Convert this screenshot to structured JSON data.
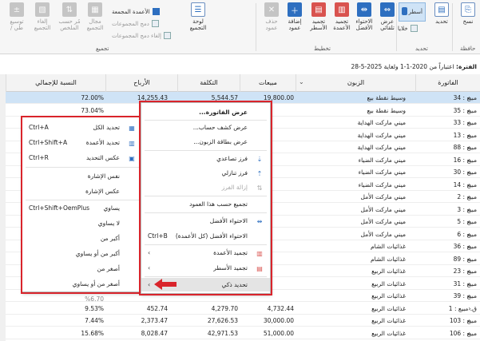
{
  "ribbon": {
    "nav_label": "حافظة",
    "nav_copy": "نسخ",
    "select_label": "تحديد",
    "active_button": "أسطر",
    "panels_label": "خلايا",
    "fit_best": "الاحتواء\nالأفضل",
    "fit_auto": "عرض\nتلقائي",
    "fit_all_cols": "تجميد\nالأعمدة",
    "freeze_rows": "تجميد\nالأسطر",
    "add_col": "إضافة\nعمود",
    "delete_col": "حذف\nعمود",
    "layout_group": "تخطيط",
    "group_panel": "لوحة\nالتجميع",
    "merge_cols": "الأعمدة المجمعة",
    "merge_groups": "دمج المجموعات",
    "cancel_merge": "إلغاء دمج المجموعات",
    "grouping_group": "تجميع",
    "sum_group": "مجال\nالتجميع",
    "calc_by": "مُر حسب\nالملخص",
    "cancel_group": "إلغاء\nالتجميع",
    "expand": "توسيع\n/ طي"
  },
  "filter": {
    "label": "الفترة:",
    "text": " اعتباراً من 2020-1-1 ولغاية 2025-5-28"
  },
  "grid": {
    "headers": {
      "invoice": "الفاتورة",
      "customer": "الزبون",
      "sales": "مبيعات",
      "cost": "التكلفة",
      "profit": "الأرباح",
      "pct": "النسبة للإجمالي"
    },
    "rows": [
      {
        "inv": "مبيع : 34",
        "cust": "وسيط نقطة بيع",
        "sales": "19,800.00",
        "cost": "5,544.57",
        "profit": "14,255.43",
        "pct": "72.00%"
      },
      {
        "inv": "مبيع : 35",
        "cust": "وسيط نقطة بيع",
        "sales": "",
        "cost": "",
        "profit": "",
        "pct": "73.04%"
      },
      {
        "inv": "مبيع : 33",
        "cust": "ميني ماركت الهداية",
        "sales": "",
        "cost": "",
        "profit": "",
        "pct": ""
      },
      {
        "inv": "مبيع : 13",
        "cust": "ميني ماركت الهداية",
        "sales": "",
        "cost": "",
        "profit": "",
        "pct": ""
      },
      {
        "inv": "مبيع : 88",
        "cust": "ميني ماركت الهداية",
        "sales": "",
        "cost": "",
        "profit": "",
        "pct": ""
      },
      {
        "inv": "مبيع : 16",
        "cust": "ميني ماركت الضياء",
        "sales": "",
        "cost": "",
        "profit": "",
        "pct": ""
      },
      {
        "inv": "مبيع : 30",
        "cust": "ميني ماركت الضياء",
        "sales": "",
        "cost": "",
        "profit": "",
        "pct": ""
      },
      {
        "inv": "مبيع : 14",
        "cust": "ميني ماركت الضياء",
        "sales": "",
        "cost": "",
        "profit": "",
        "pct": ""
      },
      {
        "inv": "مبيع : 2",
        "cust": "ميني ماركت الأمل",
        "sales": "",
        "cost": "",
        "profit": "",
        "pct": ""
      },
      {
        "inv": "مبيع : 3",
        "cust": "ميني ماركت الأمل",
        "sales": "",
        "cost": "",
        "profit": "",
        "pct": ""
      },
      {
        "inv": "مبيع : 5",
        "cust": "ميني ماركت الأمل",
        "sales": "",
        "cost": "",
        "profit": "",
        "pct": ""
      },
      {
        "inv": "مبيع : 6",
        "cust": "ميني ماركت الأمل",
        "sales": "",
        "cost": "",
        "profit": "",
        "pct": ""
      },
      {
        "inv": "مبيع : 36",
        "cust": "غذائيات الشام",
        "sales": "",
        "cost": "",
        "profit": "",
        "pct": ""
      },
      {
        "inv": "مبيع : 89",
        "cust": "غذائيات الشام",
        "sales": "",
        "cost": "",
        "profit": "",
        "pct": ""
      },
      {
        "inv": "مبيع : 23",
        "cust": "غذائيات الربيع",
        "sales": "",
        "cost": "",
        "profit": "",
        "pct": ""
      },
      {
        "inv": "مبيع : 31",
        "cust": "غذائيات الربيع",
        "sales": "",
        "cost": "",
        "profit": "",
        "pct": ""
      },
      {
        "inv": "مبيع : 39",
        "cust": "غذائيات الربيع",
        "sales": "",
        "cost": "",
        "profit": "",
        "pct": ""
      },
      {
        "inv": "ق. مبيع : 1",
        "cust": "غذائيات الربيع",
        "sales": "4,732.44",
        "cost": "4,279.70",
        "profit": "452.74",
        "pct": "9.53%"
      },
      {
        "inv": "مبيع : 103",
        "cust": "غذائيات الربيع",
        "sales": "30,000.00",
        "cost": "27,626.53",
        "profit": "2,373.47",
        "pct": "7.44%"
      },
      {
        "inv": "مبيع : 106",
        "cust": "غذائيات الربيع",
        "sales": "51,000.00",
        "cost": "42,971.53",
        "profit": "8,028.47",
        "pct": "15.68%"
      }
    ],
    "partial_pct": "%6.70"
  },
  "menu_main": {
    "title": "عرض الفاتورة...",
    "show_statement": "عرض كشف حساب...",
    "show_card": "عرض بطاقة الزبون...",
    "sort_asc": "فرز تصاعدي",
    "sort_desc": "فرز تنازلي",
    "clear_sort": "إزالة الفرز",
    "group_by_col": "تجميع حسب هذا العمود",
    "best_fit": "الاحتواء الأفضل",
    "best_fit_all": "الاحتواء الأفضل (كل الأعمدة)",
    "best_fit_all_sc": "Ctrl+B",
    "freeze_cols": "تجميد الأعمدة",
    "freeze_rows": "تجميد الأسطر",
    "smart_select": "تحديد ذكي"
  },
  "menu_sub": {
    "select_all": "تحديد الكل",
    "select_all_sc": "Ctrl+A",
    "select_cols": "تحديد الأعمدة",
    "select_cols_sc": "Ctrl+Shift+A",
    "invert": "عكس التحديد",
    "invert_sc": "Ctrl+R",
    "same_sign": "نفس الإشارة",
    "opposite_sign": "عكس الإشارة",
    "equal": "يساوي",
    "equal_sc": "Ctrl+Shift+OemPlus",
    "not_equal": "لا يساوي",
    "greater": "أكبر من",
    "greater_eq": "أكبر من أو يساوي",
    "less": "أصغر من",
    "less_eq": "أصغر من أو يساوي"
  },
  "colors": {
    "accent": "#2e6fc0",
    "highlight": "#cfe3f6",
    "annotation": "#d9242b"
  }
}
